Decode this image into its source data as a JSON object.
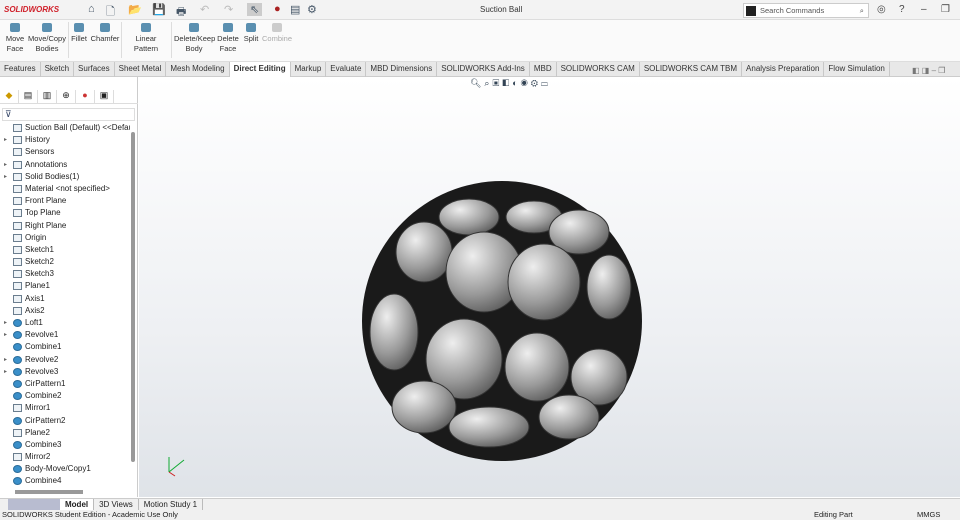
{
  "app": {
    "logo": "SOLIDWORKS",
    "title": "Suction Ball"
  },
  "search": {
    "placeholder": "Search Commands"
  },
  "ribbon": [
    {
      "label": "Move\nFace"
    },
    {
      "label": "Move/Copy\nBodies"
    },
    {
      "label": "Fillet"
    },
    {
      "label": "Chamfer"
    },
    {
      "label": "Linear Pattern"
    },
    {
      "label": "Delete/Keep\nBody"
    },
    {
      "label": "Delete\nFace"
    },
    {
      "label": "Split"
    },
    {
      "label": "Combine"
    }
  ],
  "tabs": [
    "Features",
    "Sketch",
    "Surfaces",
    "Sheet Metal",
    "Mesh Modeling",
    "Direct Editing",
    "Markup",
    "Evaluate",
    "MBD Dimensions",
    "SOLIDWORKS Add-Ins",
    "MBD",
    "SOLIDWORKS CAM",
    "SOLIDWORKS CAM TBM",
    "Analysis Preparation",
    "Flow Simulation"
  ],
  "active_tab": "Direct Editing",
  "tree": [
    {
      "label": "Suction Ball (Default) <<Default>",
      "exp": false
    },
    {
      "label": "History",
      "exp": true
    },
    {
      "label": "Sensors",
      "exp": false
    },
    {
      "label": "Annotations",
      "exp": true
    },
    {
      "label": "Solid Bodies(1)",
      "exp": true
    },
    {
      "label": "Material <not specified>",
      "exp": false
    },
    {
      "label": "Front Plane",
      "exp": false
    },
    {
      "label": "Top Plane",
      "exp": false
    },
    {
      "label": "Right Plane",
      "exp": false
    },
    {
      "label": "Origin",
      "exp": false
    },
    {
      "label": "Sketch1",
      "exp": false
    },
    {
      "label": "Sketch2",
      "exp": false
    },
    {
      "label": "Sketch3",
      "exp": false
    },
    {
      "label": "Plane1",
      "exp": false
    },
    {
      "label": "Axis1",
      "exp": false
    },
    {
      "label": "Axis2",
      "exp": false
    },
    {
      "label": "Loft1",
      "exp": true,
      "feat": true
    },
    {
      "label": "Revolve1",
      "exp": true,
      "feat": true
    },
    {
      "label": "Combine1",
      "exp": false,
      "feat": true
    },
    {
      "label": "Revolve2",
      "exp": true,
      "feat": true
    },
    {
      "label": "Revolve3",
      "exp": true,
      "feat": true
    },
    {
      "label": "CirPattern1",
      "exp": false,
      "feat": true
    },
    {
      "label": "Combine2",
      "exp": false,
      "feat": true
    },
    {
      "label": "Mirror1",
      "exp": false
    },
    {
      "label": "CirPattern2",
      "exp": false,
      "feat": true
    },
    {
      "label": "Plane2",
      "exp": false
    },
    {
      "label": "Combine3",
      "exp": false,
      "feat": true
    },
    {
      "label": "Mirror2",
      "exp": false
    },
    {
      "label": "Body-Move/Copy1",
      "exp": false,
      "feat": true
    },
    {
      "label": "Combine4",
      "exp": false,
      "feat": true
    }
  ],
  "bottom_tabs": [
    "Model",
    "3D Views",
    "Motion Study 1"
  ],
  "status": {
    "left": "SOLIDWORKS Student Edition - Academic Use Only",
    "mode": "Editing Part",
    "units": "MMGS"
  }
}
